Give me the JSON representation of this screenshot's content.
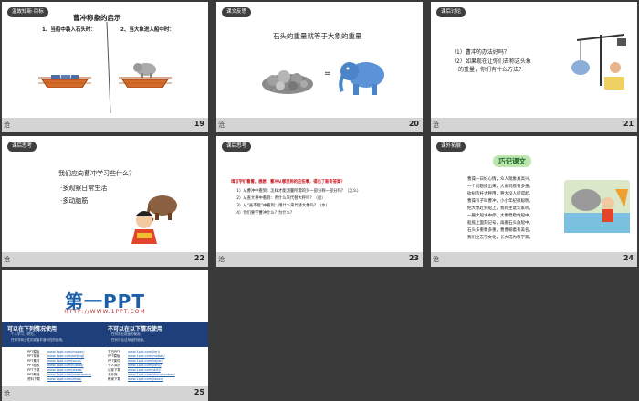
{
  "strip_mark": "沧",
  "slides": [
    {
      "num": "19",
      "tag": "温故知新·目标",
      "title": "曹冲称象的启示",
      "left_label": "1、当船中装入石头时：",
      "right_label": "2、当大象进入船中时："
    },
    {
      "num": "20",
      "tag": "课文反思",
      "title": "石头的重量就等于大象的重量",
      "equals": "="
    },
    {
      "num": "21",
      "tag": "课后讨论",
      "q1": "（1）曹冲的办法好吗？",
      "q2a": "（2）如果现在让你们去称这头象",
      "q2b": "的重量，你们有什么方法？"
    },
    {
      "num": "22",
      "tag": "课后思考",
      "q": "我们应向曹冲学习些什么？",
      "b1": "·多观察日常生活",
      "b2": "·多动脑筋"
    },
    {
      "num": "23",
      "tag": "课后思考",
      "head": "填写学们看看，想想，曹冲从哪里称的这些事，得出了新奇答案？",
      "lines": [
        "（1）从曹冲中看到：怎样才能测量所需的另一部分称一部分吗？（怎么）",
        "（2）从查大秤中看到：用什么来代替大秤吗？（船）",
        "（3）从“画不能”中看到：用什么来代替大象吗？（水）",
        "（4）你们要学曹冲什么？为什么？"
      ]
    },
    {
      "num": "24",
      "tag": "课外拓展",
      "badge": "巧记课文",
      "lines": [
        "曹操一日好心情，众人观象真高兴。",
        "一个问题提出来，大象到底有多重。",
        "砍树造杆大秤用，秤大没人提得起。",
        "曹操有子叫曹冲，小小年纪很聪明。",
        "把大象赶到船上，我有主意大家听。",
        "一艘大船水中停，大象稳稳站船中。",
        "船舷上面刻记号，再搬石头放船中。",
        "石头多重象多重，曹曹躺着有美名。",
        "我们立志学文化，长大成为科学家。"
      ]
    },
    {
      "num": "25",
      "brand": "第一PPT",
      "url": "HTTP://WWW.1PPT.COM",
      "can_title": "可以在下列情况使用",
      "cannot_title": "不可以在以下情况使用",
      "can_items": [
        "个人学习、研究。",
        "任何非商业性的或者非营利性的使用。"
      ],
      "cannot_items": [
        "任何商业用途的使用。",
        "任何非合法用途的使用。"
      ],
      "link_labels": [
        "PPT模板",
        "PPT背景",
        "PPT素材",
        "PPT图表",
        "PPT下载",
        "PPT教程",
        "资料下载"
      ],
      "links": [
        "www.1ppt.com/moban/",
        "www.1ppt.com/beijing/",
        "www.1ppt.com/sucai/",
        "www.1ppt.com/tubiao/",
        "www.1ppt.com/xiazai/",
        "www.1ppt.com/powerpoint/",
        "www.1ppt.com/ziliao/"
      ],
      "link_labels2": [
        "节日PPT",
        "PPT模板",
        "PPT课件",
        "个人简历",
        "试卷下载",
        "手抄报",
        "教案下载"
      ],
      "links2": [
        "www.1ppt.com/jieri/",
        "www.1ppt.com/moban/",
        "www.1ppt.com/kejian/",
        "www.1ppt.com/jianli/",
        "www.1ppt.com/shiti/",
        "www.1ppt.com/shouchaobao/",
        "www.1ppt.com/jiaoan/"
      ]
    }
  ]
}
